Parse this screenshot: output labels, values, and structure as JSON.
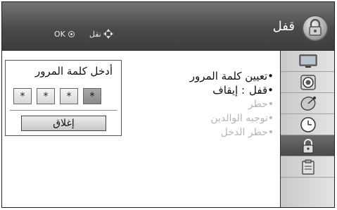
{
  "header": {
    "title": "قفل",
    "hint_ok": "OK",
    "hint_move": "نقل"
  },
  "menu": {
    "items": [
      {
        "bullet": "•",
        "label": "تعيين كلمة المرور",
        "value": "",
        "state": "active"
      },
      {
        "bullet": "•",
        "label": "قفل",
        "value": ": إيقاف",
        "state": "active"
      },
      {
        "bullet": "•",
        "label": "حظر",
        "value": "",
        "state": "dim"
      },
      {
        "bullet": "•",
        "label": "توجيه الوالدين",
        "value": "",
        "state": "dim"
      },
      {
        "bullet": "•",
        "label": "حظر الدخل",
        "value": "",
        "state": "dim"
      }
    ]
  },
  "dialog": {
    "title": "أدخل كلمة المرور",
    "pins": [
      "*",
      "*",
      "*",
      "*"
    ],
    "close_label": "إغلاق"
  },
  "sidebar": {
    "icons": [
      "picture-icon",
      "audio-icon",
      "channel-icon",
      "time-icon",
      "lock-icon",
      "option-icon"
    ],
    "selected": "lock-icon"
  },
  "colors": {
    "header_bg": "#4a4a4a",
    "selected_tab": "#555555",
    "dim_text": "#b5b5b5"
  }
}
